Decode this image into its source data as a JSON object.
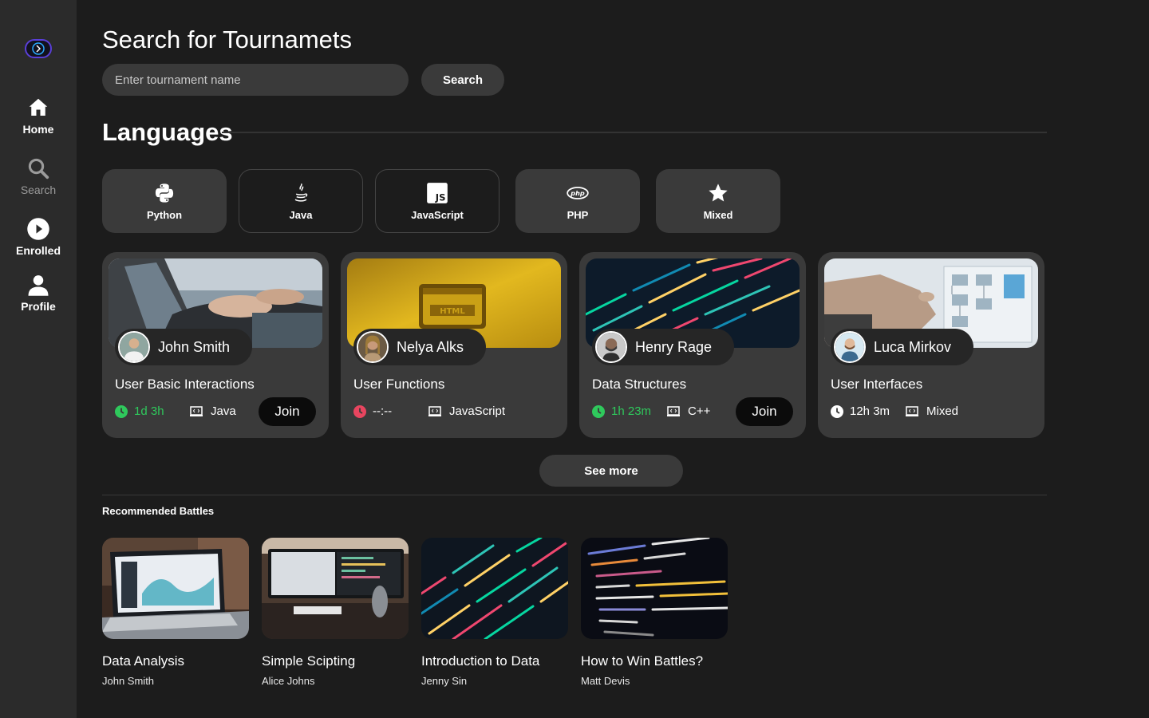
{
  "sidebar": {
    "items": [
      {
        "label": "Home"
      },
      {
        "label": "Search"
      },
      {
        "label": "Enrolled"
      },
      {
        "label": "Profile"
      }
    ]
  },
  "search": {
    "title": "Search for Tournamets",
    "placeholder": "Enter tournament name",
    "button_label": "Search"
  },
  "languages": {
    "title": "Languages",
    "items": [
      {
        "label": "Python",
        "icon": "python-icon"
      },
      {
        "label": "Java",
        "icon": "java-icon"
      },
      {
        "label": "JavaScript",
        "icon": "javascript-icon"
      },
      {
        "label": "PHP",
        "icon": "php-icon"
      },
      {
        "label": "Mixed",
        "icon": "star-icon"
      }
    ]
  },
  "tournaments": [
    {
      "host": "John Smith",
      "title": "User Basic Interactions",
      "time": "1d 3h",
      "language": "Java",
      "join_label": "Join",
      "status_color": "#2fc95c"
    },
    {
      "host": "Nelya Alks",
      "title": "User Functions",
      "time": "--:--",
      "language": "JavaScript",
      "status_color": "#e8455f"
    },
    {
      "host": "Henry Rage",
      "title": "Data Structures",
      "time": "1h 23m",
      "language": "C++",
      "join_label": "Join",
      "status_color": "#2fc95c"
    },
    {
      "host": "Luca Mirkov",
      "title": "User Interfaces",
      "time": "12h 3m",
      "language": "Mixed",
      "status_color": "#ffffff"
    }
  ],
  "see_more_label": "See more",
  "recommended": {
    "title": "Recommended Battles",
    "items": [
      {
        "title": "Data Analysis",
        "author": "John Smith"
      },
      {
        "title": "Simple Scipting",
        "author": "Alice Johns"
      },
      {
        "title": "Introduction to Data",
        "author": "Jenny Sin"
      },
      {
        "title": "How to Win Battles?",
        "author": "Matt Devis"
      }
    ]
  },
  "colors": {
    "accent_green": "#2fc95c",
    "accent_red": "#e8455f",
    "card_bg": "#3a3a3a",
    "page_bg": "#1c1c1c"
  }
}
